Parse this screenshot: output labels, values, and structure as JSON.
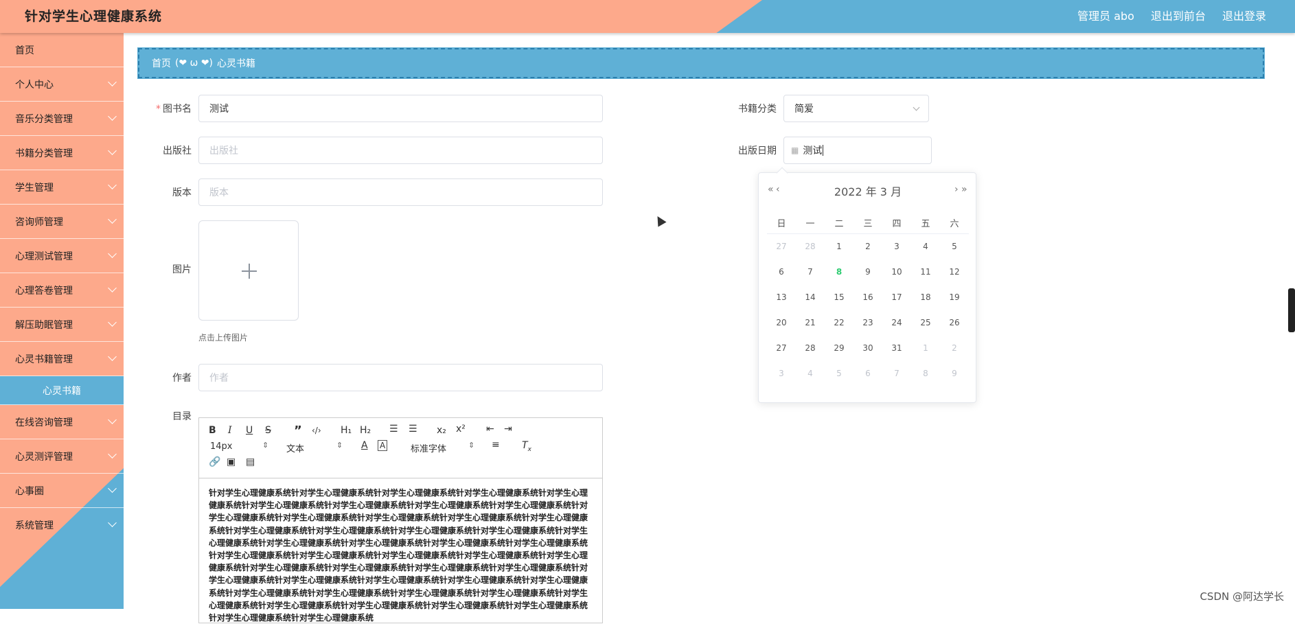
{
  "header": {
    "title": "针对学生心理健康系统",
    "user": "管理员 abo",
    "front_link": "退出到前台",
    "logout_link": "退出登录"
  },
  "sidebar": {
    "items": [
      {
        "label": "首页"
      },
      {
        "label": "个人中心"
      },
      {
        "label": "音乐分类管理"
      },
      {
        "label": "书籍分类管理"
      },
      {
        "label": "学生管理"
      },
      {
        "label": "咨询师管理"
      },
      {
        "label": "心理测试管理"
      },
      {
        "label": "心理答卷管理"
      },
      {
        "label": "解压助眠管理"
      },
      {
        "label": "心灵书籍管理"
      }
    ],
    "active_sub": "心灵书籍",
    "items_after": [
      {
        "label": "在线咨询管理"
      },
      {
        "label": "心灵测评管理"
      },
      {
        "label": "心事圈"
      },
      {
        "label": "系统管理"
      }
    ]
  },
  "breadcrumb": {
    "home": "首页",
    "emoji": "(❤ ω ❤)",
    "current": "心灵书籍"
  },
  "form": {
    "book_name": {
      "label": "图书名",
      "value": "测试"
    },
    "publisher": {
      "label": "出版社",
      "placeholder": "出版社"
    },
    "edition": {
      "label": "版本",
      "placeholder": "版本"
    },
    "image": {
      "label": "图片",
      "hint": "点击上传图片"
    },
    "author": {
      "label": "作者",
      "placeholder": "作者"
    },
    "toc": {
      "label": "目录"
    },
    "category": {
      "label": "书籍分类",
      "value": "简爱"
    },
    "pub_date": {
      "label": "出版日期",
      "value": "测试"
    }
  },
  "editor": {
    "font_size": "14px",
    "block_type": "文本",
    "font_family": "标准字体",
    "content": "针对学生心理健康系统针对学生心理健康系统针对学生心理健康系统针对学生心理健康系统针对学生心理健康系统针对学生心理健康系统针对学生心理健康系统针对学生心理健康系统针对学生心理健康系统针对学生心理健康系统针对学生心理健康系统针对学生心理健康系统针对学生心理健康系统针对学生心理健康系统针对学生心理健康系统针对学生心理健康系统针对学生心理健康系统针对学生心理健康系统针对学生心理健康系统针对学生心理健康系统针对学生心理健康系统针对学生心理健康系统针对学生心理健康系统针对学生心理健康系统针对学生心理健康系统针对学生心理健康系统针对学生心理健康系统针对学生心理健康系统针对学生心理健康系统针对学生心理健康系统针对学生心理健康系统针对学生心理健康系统针对学生心理健康系统针对学生心理健康系统针对学生心理健康系统针对学生心理健康系统针对学生心理健康系统针对学生心理健康系统针对学生心理健康系统针对学生心理健康系统针对学生心理健康系统针对学生心理健康系统针对学生心理健康系统针对学生心理健康系统针对学生心理健康系统针对学生心理健康系统针对学生心理健康系统针对学生心理健康系统"
  },
  "datepicker": {
    "header": "2022 年  3 月",
    "prev_year": "«",
    "prev_month": "‹",
    "next_month": "›",
    "next_year": "»",
    "weekdays": [
      "日",
      "一",
      "二",
      "三",
      "四",
      "五",
      "六"
    ],
    "weeks": [
      [
        "27",
        "28",
        "1",
        "2",
        "3",
        "4",
        "5"
      ],
      [
        "6",
        "7",
        "8",
        "9",
        "10",
        "11",
        "12"
      ],
      [
        "13",
        "14",
        "15",
        "16",
        "17",
        "18",
        "19"
      ],
      [
        "20",
        "21",
        "22",
        "23",
        "24",
        "25",
        "26"
      ],
      [
        "27",
        "28",
        "29",
        "30",
        "31",
        "1",
        "2"
      ],
      [
        "3",
        "4",
        "5",
        "6",
        "7",
        "8",
        "9"
      ]
    ],
    "today": "8",
    "colors": {
      "today": "#2ecc71",
      "muted": "#c0c4cc"
    }
  },
  "watermark": "CSDN @阿达学长",
  "colors": {
    "salmon": "#fda98b",
    "blue": "#5fb0d6"
  }
}
